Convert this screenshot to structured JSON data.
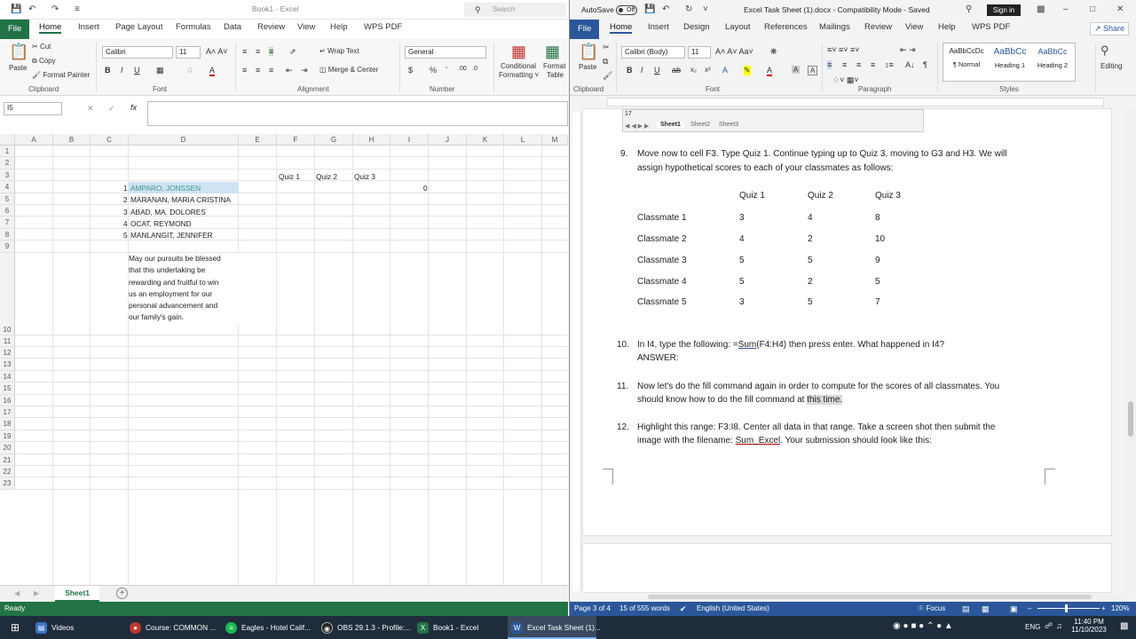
{
  "excel": {
    "title": "Book1 - Excel",
    "search": "Search",
    "tabs": [
      "File",
      "Home",
      "Insert",
      "Page Layout",
      "Formulas",
      "Data",
      "Review",
      "View",
      "Help",
      "WPS PDF"
    ],
    "clipboard": {
      "cut": "Cut",
      "copy": "Copy",
      "format_painter": "Format Painter",
      "paste": "Paste",
      "group": "Clipboard"
    },
    "font": {
      "name": "Calibri",
      "size": "11",
      "group": "Font"
    },
    "alignment": {
      "wrap": "Wrap Text",
      "merge": "Merge & Center",
      "group": "Alignment"
    },
    "number": {
      "format": "General",
      "group": "Number"
    },
    "styles": {
      "conditional": "Conditional",
      "formatting": "Formatting",
      "format_as": "Format",
      "table": "Table"
    },
    "name_box": "I5",
    "fx": "fx",
    "columns": [
      "A",
      "B",
      "C",
      "D",
      "E",
      "F",
      "G",
      "H",
      "I",
      "J",
      "K",
      "L",
      "M"
    ],
    "rows": [
      "1",
      "2",
      "3",
      "4",
      "5",
      "6",
      "7",
      "8",
      "9",
      "10",
      "11",
      "12",
      "13",
      "14",
      "15",
      "16",
      "17",
      "18",
      "19",
      "20",
      "21",
      "22",
      "23"
    ],
    "quiz_headers": [
      "Quiz 1",
      "Quiz 2",
      "Quiz 3"
    ],
    "students": [
      {
        "num": "1",
        "name": "AMPARO, JONSSEN"
      },
      {
        "num": "2",
        "name": "MARANAN, MARIA CRISTINA"
      },
      {
        "num": "3",
        "name": "ABAD, MA. DOLORES"
      },
      {
        "num": "4",
        "name": "OCAT, REYMOND"
      },
      {
        "num": "5",
        "name": "MANLANGIT, JENNIFER"
      }
    ],
    "i4_value": "0",
    "note": [
      "May our pursuits be blessed",
      "that this undertaking be",
      "rewarding and fruitful to win",
      "us an employment for our",
      "personal advancement and",
      "our family's gain."
    ],
    "sheet_tab": "Sheet1",
    "status": "Ready"
  },
  "word": {
    "autosave": "AutoSave",
    "autosave_state": "Off",
    "title": "Excel Task Sheet (1).docx - Compatibility Mode - Saved",
    "sign_in": "Sign in",
    "share": "Share",
    "tabs": [
      "File",
      "Home",
      "Insert",
      "Design",
      "Layout",
      "References",
      "Mailings",
      "Review",
      "View",
      "Help",
      "WPS PDF"
    ],
    "paste": "Paste",
    "font_name": "Calibri (Body)",
    "font_size": "11",
    "styles": [
      {
        "preview": "AaBbCcDc",
        "name": "¶ Normal"
      },
      {
        "preview": "AaBbCc",
        "name": "Heading 1"
      },
      {
        "preview": "AaBbCc",
        "name": "Heading 2"
      }
    ],
    "editing": "Editing",
    "groups": {
      "clipboard": "Clipboard",
      "font": "Font",
      "paragraph": "Paragraph",
      "styles": "Styles"
    },
    "embedded_sheets": [
      "Sheet1",
      "Sheet2",
      "Sheet3"
    ],
    "embedded_row": "17",
    "item9": {
      "num": "9.",
      "lines": [
        "Move now to cell F3.  Type Quiz 1.  Continue typing up to Quiz 3, moving to G3 and H3.  We will",
        "assign hypothetical scores to each of your classmates as follows:"
      ]
    },
    "score_table": {
      "headers": [
        "Quiz 1",
        "Quiz 2",
        "Quiz 3"
      ],
      "rows": [
        {
          "label": "Classmate 1",
          "values": [
            "3",
            "4",
            "8"
          ]
        },
        {
          "label": "Classmate 2",
          "values": [
            "4",
            "2",
            "10"
          ]
        },
        {
          "label": "Classmate 3",
          "values": [
            "5",
            "5",
            "9"
          ]
        },
        {
          "label": "Classmate 4",
          "values": [
            "5",
            "2",
            "5"
          ]
        },
        {
          "label": "Classmate 5",
          "values": [
            "3",
            "5",
            "7"
          ]
        }
      ]
    },
    "item10": {
      "num": "10.",
      "pre": "In I4, type the following:  =",
      "sum": "Sum",
      "post": "(F4:H4) then press enter.  What happened in I4?",
      "answer": "ANSWER:"
    },
    "item11": {
      "num": "11.",
      "line1": "Now let's do the fill command again in order to compute for the scores of all classmates. You",
      "line2_pre": "should know how to do the fill command at ",
      "line2_hl": "this time."
    },
    "item12": {
      "num": "12.",
      "line1": "Highlight this range: F3:I8. Center all data in that range.  Take a screen shot then submit the",
      "line2_pre": "image with the filename: ",
      "line2_file": "Sum_Excel",
      "line2_post": ". Your submission should look like this:"
    },
    "status": {
      "page": "Page 3 of 4",
      "words": "15 of 555 words",
      "lang": "English (United States)",
      "focus": "Focus",
      "zoom": "120%"
    }
  },
  "taskbar": {
    "items": [
      "Videos",
      "Course: COMMON ...",
      "Eagles - Hotel Calif...",
      "OBS 29.1.3 - Profile:...",
      "Book1 - Excel",
      "Excel Task Sheet (1)..."
    ],
    "lang": "ENG",
    "time": "11:40 PM",
    "date": "11/10/2023"
  },
  "colors": {
    "excel_green": "#217346",
    "word_blue": "#2b579a",
    "selection": "#cfe2f3",
    "name_text": "#3c9a8a"
  }
}
